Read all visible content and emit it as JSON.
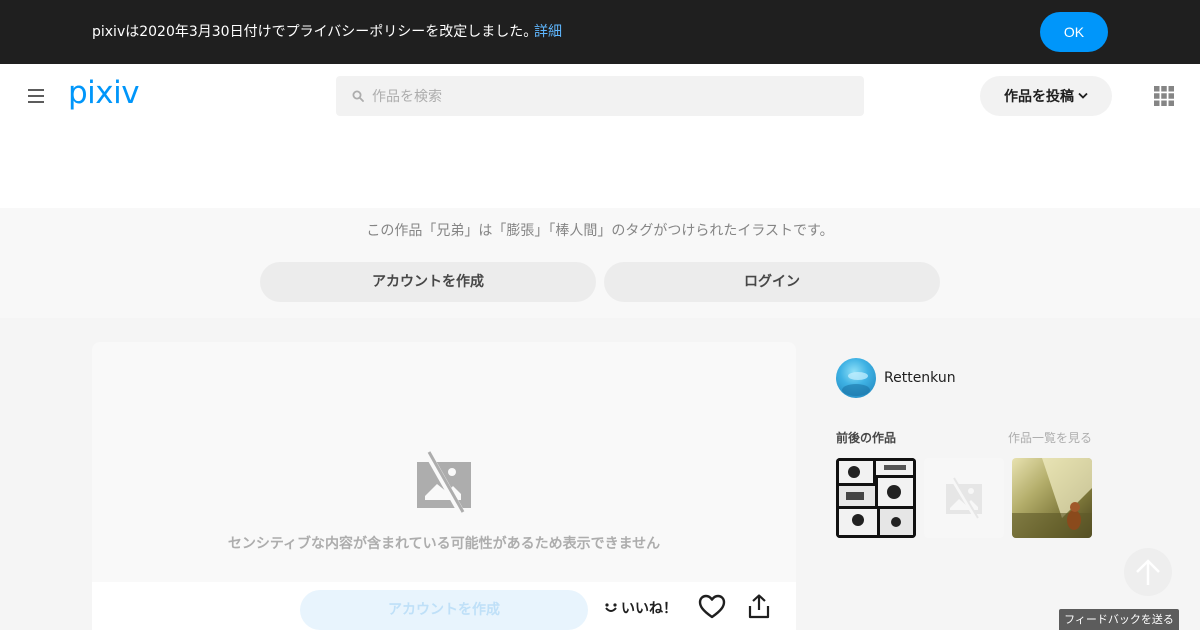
{
  "notice": {
    "text": "pixivは2020年3月30日付けでプライバシーポリシーを改定しました。",
    "link": "詳細",
    "ok": "OK"
  },
  "header": {
    "logo": "pixiv",
    "search_placeholder": "作品を検索",
    "post_label": "作品を投稿"
  },
  "banner": {
    "text": "この作品「兄弟」は「膨張」「棒人間」のタグがつけられたイラストです。",
    "create_label": "アカウントを作成",
    "login_label": "ログイン"
  },
  "artwork": {
    "sensitive_text": "センシティブな内容が含まれている可能性があるため表示できません",
    "create_label": "アカウントを作成",
    "like_label": "いいね！"
  },
  "sidebar": {
    "username": "Rettenkun",
    "prevnext_title": "前後の作品",
    "see_all": "作品一覧を見る"
  },
  "feedback": "フィードバックを送る",
  "colors": {
    "brand": "#0096fa",
    "notice_bg": "#1f1f1f"
  }
}
